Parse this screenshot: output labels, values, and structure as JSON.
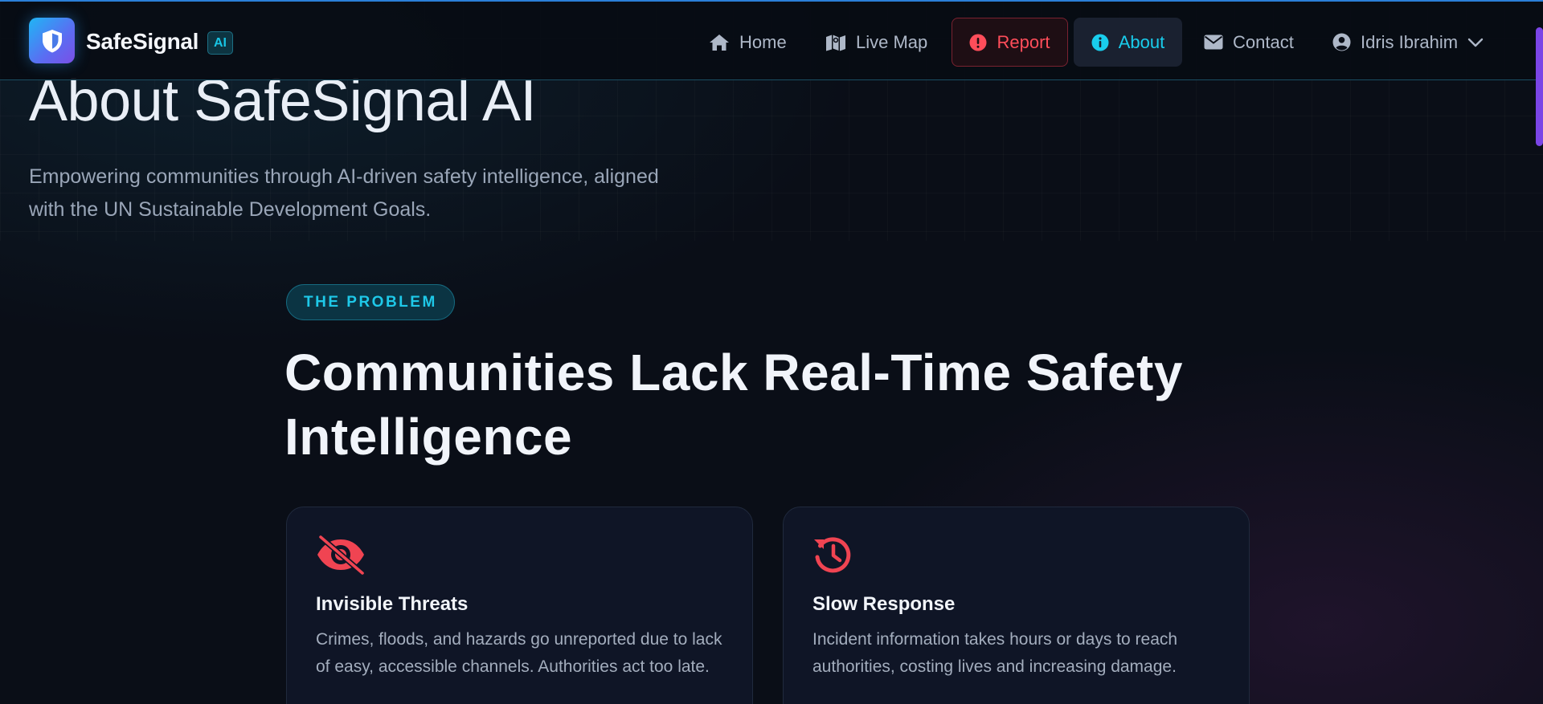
{
  "brand": {
    "name": "SafeSignal",
    "badge": "AI"
  },
  "nav": {
    "home": "Home",
    "live_map": "Live Map",
    "report": "Report",
    "about": "About",
    "contact": "Contact",
    "user": "Idris Ibrahim"
  },
  "hero": {
    "title": "About SafeSignal AI",
    "subtitle": "Empowering communities through AI-driven safety intelligence, aligned with the UN Sustainable Development Goals."
  },
  "problem": {
    "pill": "THE PROBLEM",
    "title": "Communities Lack Real-Time Safety Intelligence",
    "cards": [
      {
        "icon": "eye-slash-icon",
        "title": "Invisible Threats",
        "text": "Crimes, floods, and hazards go unreported due to lack of easy, accessible channels. Authorities act too late."
      },
      {
        "icon": "clock-rotate-icon",
        "title": "Slow Response",
        "text": "Incident information takes hours or days to reach authorities, costing lives and increasing damage."
      }
    ]
  },
  "colors": {
    "accent": "#19cdec",
    "danger": "#ff4d5a",
    "background": "#0a0e17",
    "card": "#0f1526"
  }
}
